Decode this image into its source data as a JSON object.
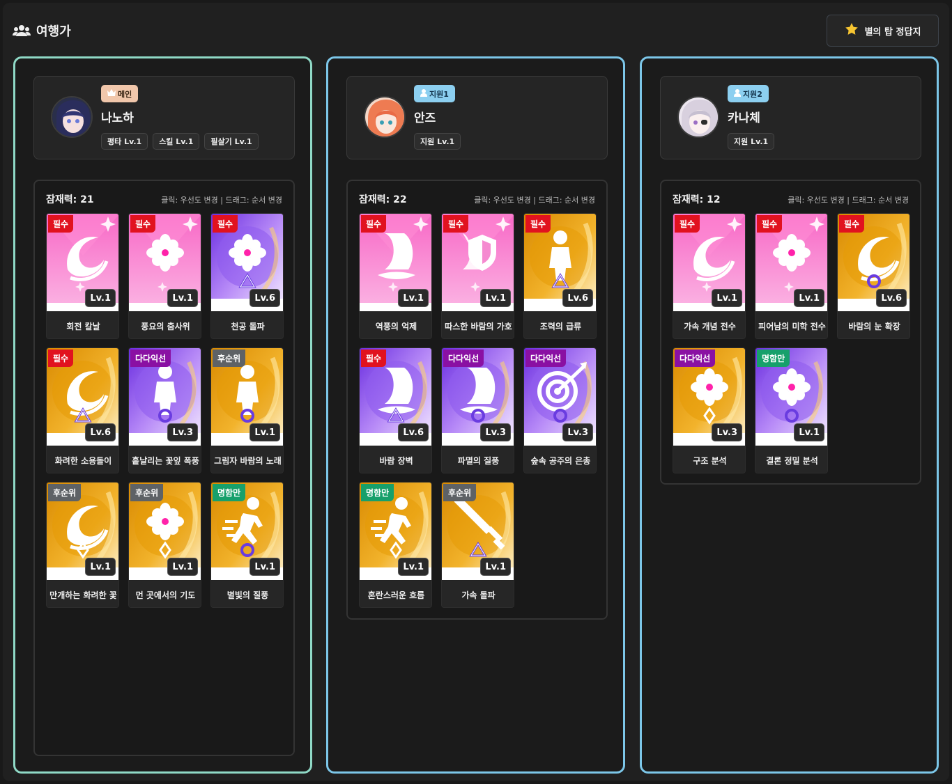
{
  "header": {
    "title": "여행가",
    "title_icon": "users-icon",
    "answer_button_label": "별의 탑 정답지",
    "answer_button_icon": "star-icon"
  },
  "colors": {
    "required": "#e1121f",
    "multi": "#8a10a3",
    "lowpri": "#5e6266",
    "fame": "#17a06b",
    "pink": "#f266c2",
    "purple": "#9a5cf0",
    "gold": "#eda514"
  },
  "columns": [
    {
      "name": "나노하",
      "role": "메인",
      "role_icon": "crown-icon",
      "skills": [
        "평타 Lv.1",
        "스킬 Lv.1",
        "필살기 Lv.1"
      ],
      "potential_label": "잠재력: 21",
      "hint": "클릭: 우선도 변경 | 드래그: 순서 변경",
      "cards": [
        {
          "tag": "필수",
          "tag_kind": "required",
          "level": "Lv.1",
          "name": "회전 칼날",
          "art": "pink",
          "symbol": "swirl"
        },
        {
          "tag": "필수",
          "tag_kind": "required",
          "level": "Lv.1",
          "name": "풍요의 춤사위",
          "art": "pink",
          "symbol": "flower"
        },
        {
          "tag": "필수",
          "tag_kind": "required",
          "level": "Lv.6",
          "name": "천공 돌파",
          "art": "purple",
          "symbol": "flower",
          "mark": "triangle"
        },
        {
          "tag": "필수",
          "tag_kind": "required",
          "level": "Lv.6",
          "name": "화려한 소용돌이",
          "art": "gold",
          "symbol": "swirl",
          "mark": "triangle"
        },
        {
          "tag": "다다익선",
          "tag_kind": "multi",
          "level": "Lv.3",
          "name": "흩날리는 꽃잎 폭풍",
          "art": "purple",
          "symbol": "figure",
          "mark": "circle"
        },
        {
          "tag": "후순위",
          "tag_kind": "lowpri",
          "level": "Lv.1",
          "name": "그림자 바람의 노래",
          "art": "gold",
          "symbol": "figure",
          "mark": "circle"
        },
        {
          "tag": "후순위",
          "tag_kind": "lowpri",
          "level": "Lv.1",
          "name": "만개하는 화려한 꽃",
          "art": "gold",
          "symbol": "swirl",
          "mark": "diamond"
        },
        {
          "tag": "후순위",
          "tag_kind": "lowpri",
          "level": "Lv.1",
          "name": "먼 곳에서의 기도",
          "art": "gold",
          "symbol": "flower",
          "mark": "diamond"
        },
        {
          "tag": "명함만",
          "tag_kind": "fame",
          "level": "Lv.1",
          "name": "별빛의 질풍",
          "art": "gold",
          "symbol": "runner",
          "mark": "circle"
        }
      ]
    },
    {
      "name": "안즈",
      "role": "지원1",
      "role_icon": "person-icon",
      "skills": [
        "지원 Lv.1"
      ],
      "potential_label": "잠재력: 22",
      "hint": "클릭: 우선도 변경 | 드래그: 순서 변경",
      "cards": [
        {
          "tag": "필수",
          "tag_kind": "required",
          "level": "Lv.1",
          "name": "역풍의 억제",
          "art": "pink",
          "symbol": "sail"
        },
        {
          "tag": "필수",
          "tag_kind": "required",
          "level": "Lv.1",
          "name": "따스한 바람의 가호",
          "art": "pink",
          "symbol": "shield"
        },
        {
          "tag": "필수",
          "tag_kind": "required",
          "level": "Lv.6",
          "name": "조력의 급류",
          "art": "gold",
          "symbol": "figure",
          "mark": "triangle"
        },
        {
          "tag": "필수",
          "tag_kind": "required",
          "level": "Lv.6",
          "name": "바람 장벽",
          "art": "purple",
          "symbol": "sail",
          "mark": "triangle"
        },
        {
          "tag": "다다익선",
          "tag_kind": "multi",
          "level": "Lv.3",
          "name": "파멸의 질풍",
          "art": "purple",
          "symbol": "sail",
          "mark": "circle"
        },
        {
          "tag": "다다익선",
          "tag_kind": "multi",
          "level": "Lv.3",
          "name": "숲속 공주의 은총",
          "art": "purple",
          "symbol": "target",
          "mark": "circle"
        },
        {
          "tag": "명함만",
          "tag_kind": "fame",
          "level": "Lv.1",
          "name": "혼란스러운 흐름",
          "art": "gold",
          "symbol": "runner",
          "mark": "diamond"
        },
        {
          "tag": "후순위",
          "tag_kind": "lowpri",
          "level": "Lv.1",
          "name": "가속 돌파",
          "art": "gold",
          "symbol": "sword",
          "mark": "triangle"
        }
      ]
    },
    {
      "name": "카나체",
      "role": "지원2",
      "role_icon": "person-icon",
      "skills": [
        "지원 Lv.1"
      ],
      "potential_label": "잠재력: 12",
      "hint": "클릭: 우선도 변경 | 드래그: 순서 변경",
      "cards": [
        {
          "tag": "필수",
          "tag_kind": "required",
          "level": "Lv.1",
          "name": "가속 개념 전수",
          "art": "pink",
          "symbol": "swirl"
        },
        {
          "tag": "필수",
          "tag_kind": "required",
          "level": "Lv.1",
          "name": "피어남의 미학 전수",
          "art": "pink",
          "symbol": "flower"
        },
        {
          "tag": "필수",
          "tag_kind": "required",
          "level": "Lv.6",
          "name": "바람의 눈 확장",
          "art": "gold",
          "symbol": "swirl",
          "mark": "circle"
        },
        {
          "tag": "다다익선",
          "tag_kind": "multi",
          "level": "Lv.3",
          "name": "구조 분석",
          "art": "gold",
          "symbol": "flower",
          "mark": "diamond"
        },
        {
          "tag": "명함만",
          "tag_kind": "fame",
          "level": "Lv.1",
          "name": "결론 정밀 분석",
          "art": "purple",
          "symbol": "flower",
          "mark": "circle"
        }
      ]
    }
  ]
}
